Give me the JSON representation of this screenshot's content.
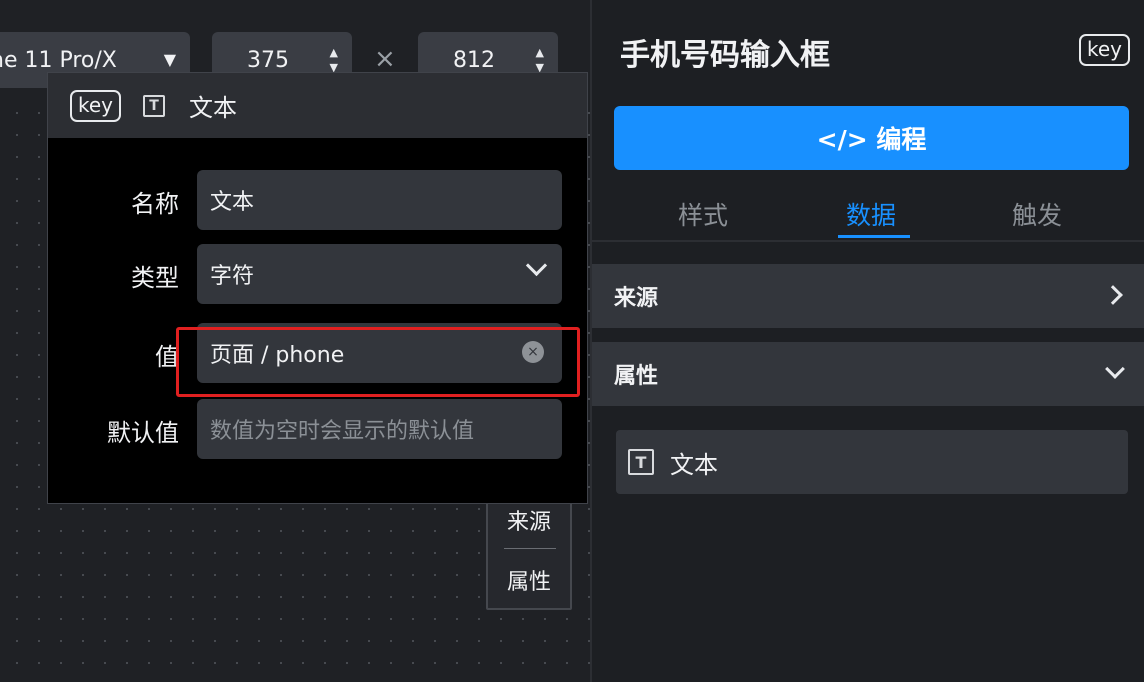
{
  "toolbar": {
    "device": "ne 11 Pro/X",
    "width": "375",
    "height": "812",
    "times": "×"
  },
  "popup": {
    "badge": "key",
    "title": "文本",
    "fields": [
      {
        "label": "名称",
        "value": "文本"
      },
      {
        "label": "类型",
        "value": "字符"
      },
      {
        "label": "值",
        "value": "页面 / phone"
      },
      {
        "label": "默认值",
        "placeholder": "数值为空时会显示的默认值"
      }
    ]
  },
  "canvas_card": {
    "source": "来源",
    "attrs": "属性"
  },
  "panel": {
    "title": "手机号码输入框",
    "badge": "key",
    "code_button": "</> 编程",
    "tabs": [
      "样式",
      "数据",
      "触发"
    ],
    "active_tab": "数据",
    "sections": [
      {
        "label": "来源",
        "state": "collapsed"
      },
      {
        "label": "属性",
        "state": "expanded"
      }
    ],
    "attr_item": "文本"
  },
  "colors": {
    "accent": "#1890ff",
    "highlight": "#e02020"
  }
}
